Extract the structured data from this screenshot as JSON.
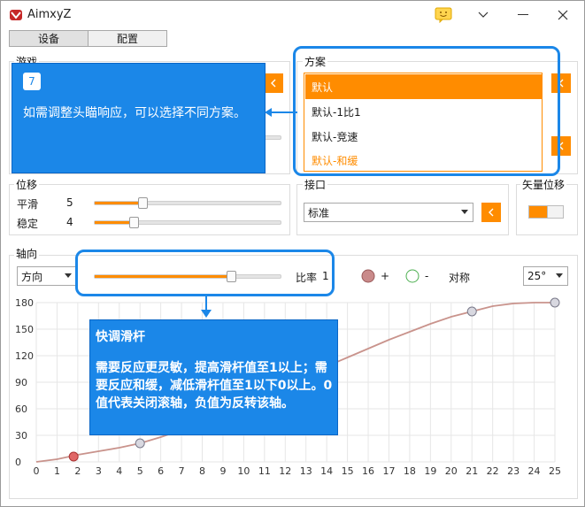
{
  "window": {
    "title": "AimxyZ"
  },
  "tabs": [
    {
      "label": "设备"
    },
    {
      "label": "配置"
    }
  ],
  "groups": {
    "game": "游戏",
    "scheme": "方案",
    "displacement": "位移",
    "interface": "接口",
    "vector_displacement": "矢量位移",
    "axis": "轴向"
  },
  "scheme_dropdown": {
    "options": [
      "默认",
      "默认-1比1",
      "默认-竞速",
      "默认-和缓"
    ],
    "selected": "默认"
  },
  "displacement": {
    "smooth_label": "平滑",
    "smooth_value": "5",
    "smooth_fraction": 0.26,
    "stable_label": "稳定",
    "stable_value": "4",
    "stable_fraction": 0.21
  },
  "interface_select": {
    "value": "标准"
  },
  "vector_toggle": {
    "on": true
  },
  "axis_controls": {
    "direction_select": "方向",
    "ratio_label": "比率",
    "ratio_value": "1",
    "ratio_fraction": 0.73,
    "plus_label": "+",
    "minus_label": "-",
    "symmetric_label": "对称",
    "angle_select": "25°"
  },
  "tooltip_step": {
    "badge": "7",
    "text": "如需调整头瞄响应，可以选择不同方案。"
  },
  "tooltip_slider": {
    "title": "快调滑杆",
    "text": "需要反应更灵敏，提高滑杆值至1以上；需要反应和缓，减低滑杆值至1以下0以上。0值代表关闭滚轴，负值为反转该轴。"
  },
  "colors": {
    "accent": "#ff8c00",
    "tip": "#1b87e8",
    "curve": "#c9938c"
  },
  "chart_data": {
    "type": "line",
    "x_ticks": [
      0,
      1,
      2,
      3,
      4,
      5,
      6,
      7,
      8,
      9,
      10,
      11,
      12,
      13,
      14,
      15,
      16,
      17,
      18,
      19,
      20,
      21,
      22,
      23,
      24,
      25
    ],
    "y_ticks": [
      0,
      30,
      60,
      90,
      120,
      150,
      180
    ],
    "xlim": [
      0,
      25
    ],
    "ylim": [
      0,
      180
    ],
    "grid": true,
    "curve": [
      [
        0,
        0
      ],
      [
        1,
        3
      ],
      [
        2,
        8
      ],
      [
        3,
        12
      ],
      [
        4,
        16
      ],
      [
        5,
        21
      ],
      [
        6,
        28
      ],
      [
        7,
        36
      ],
      [
        8,
        45
      ],
      [
        9,
        55
      ],
      [
        10,
        65
      ],
      [
        11,
        75
      ],
      [
        12,
        86
      ],
      [
        13,
        97
      ],
      [
        14,
        108
      ],
      [
        15,
        118
      ],
      [
        16,
        128
      ],
      [
        17,
        138
      ],
      [
        18,
        147
      ],
      [
        19,
        156
      ],
      [
        20,
        164
      ],
      [
        21,
        170
      ],
      [
        22,
        176
      ],
      [
        23,
        179
      ],
      [
        24,
        180
      ],
      [
        25,
        180
      ]
    ],
    "control_points": [
      {
        "x": 1.8,
        "y": 6,
        "style": "active"
      },
      {
        "x": 5,
        "y": 21,
        "style": "hollow"
      },
      {
        "x": 21,
        "y": 170,
        "style": "hollow"
      },
      {
        "x": 25,
        "y": 180,
        "style": "hollow"
      }
    ]
  },
  "icons": {
    "app": "app-logo-icon",
    "feedback": "feedback-icon",
    "minimize": "minimize-icon",
    "maximize": "maximize-icon",
    "close": "close-icon",
    "back": "chevron-left-icon"
  }
}
